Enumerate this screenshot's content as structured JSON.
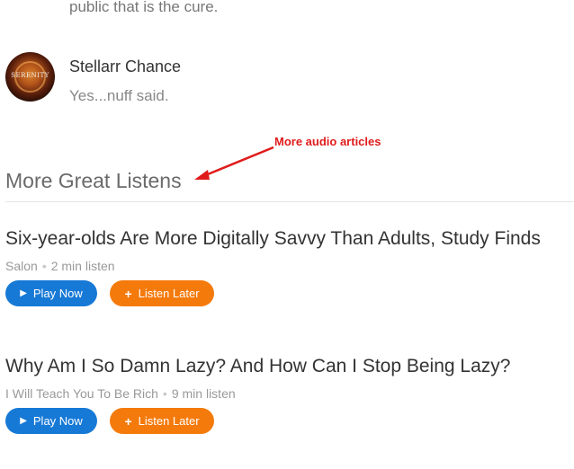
{
  "previous_comment": {
    "text": "public that is the cure."
  },
  "comment": {
    "author": "Stellarr Chance",
    "body": "Yes...nuff said.",
    "avatar_text": "SERENITY"
  },
  "annotation": {
    "text": "More audio articles",
    "color": "#e01b1b"
  },
  "section": {
    "title": "More Great Listens"
  },
  "articles": [
    {
      "title": "Six-year-olds Are More Digitally Savvy Than Adults, Study Finds",
      "source": "Salon",
      "duration": "2 min listen",
      "play_label": "Play Now",
      "later_label": "Listen Later"
    },
    {
      "title": "Why Am I So Damn Lazy? And How Can I Stop Being Lazy?",
      "source": "I Will Teach You To Be Rich",
      "duration": "9 min listen",
      "play_label": "Play Now",
      "later_label": "Listen Later"
    }
  ],
  "icons": {
    "play": "play-icon",
    "plus": "plus-icon"
  },
  "colors": {
    "play_button": "#1779d6",
    "later_button": "#f47a0c"
  }
}
